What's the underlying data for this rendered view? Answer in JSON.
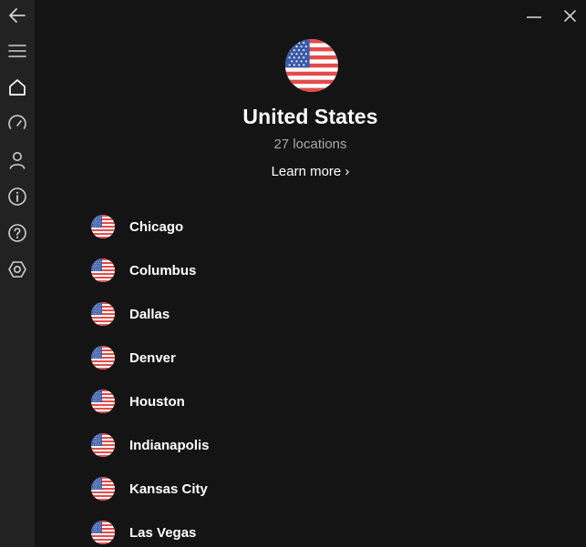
{
  "sidebar": {
    "items": [
      {
        "icon": "back-arrow-icon",
        "label": "Back"
      },
      {
        "icon": "menu-icon",
        "label": "Menu"
      },
      {
        "icon": "home-icon",
        "label": "Home"
      },
      {
        "icon": "speed-test-icon",
        "label": "Speed test"
      },
      {
        "icon": "account-icon",
        "label": "Account"
      },
      {
        "icon": "info-icon",
        "label": "Info"
      },
      {
        "icon": "help-icon",
        "label": "Help"
      },
      {
        "icon": "settings-icon",
        "label": "Settings"
      }
    ]
  },
  "window": {
    "minimize_icon": "minimize-icon",
    "close_icon": "close-icon"
  },
  "country": {
    "flag_icon": "us-flag-icon",
    "name": "United States",
    "locations": "27 locations",
    "learn_more": "Learn more ›"
  },
  "cities": [
    {
      "name": "Chicago"
    },
    {
      "name": "Columbus"
    },
    {
      "name": "Dallas"
    },
    {
      "name": "Denver"
    },
    {
      "name": "Houston"
    },
    {
      "name": "Indianapolis"
    },
    {
      "name": "Kansas City"
    },
    {
      "name": "Las Vegas"
    }
  ],
  "colors": {
    "sidebar_bg": "#222222",
    "main_bg": "#141414",
    "text_primary": "#ffffff",
    "text_secondary": "#a8a8a8",
    "icon_color": "#cfcfcf",
    "flag_red": "#e34b4b",
    "flag_blue": "#3a5ba8"
  }
}
